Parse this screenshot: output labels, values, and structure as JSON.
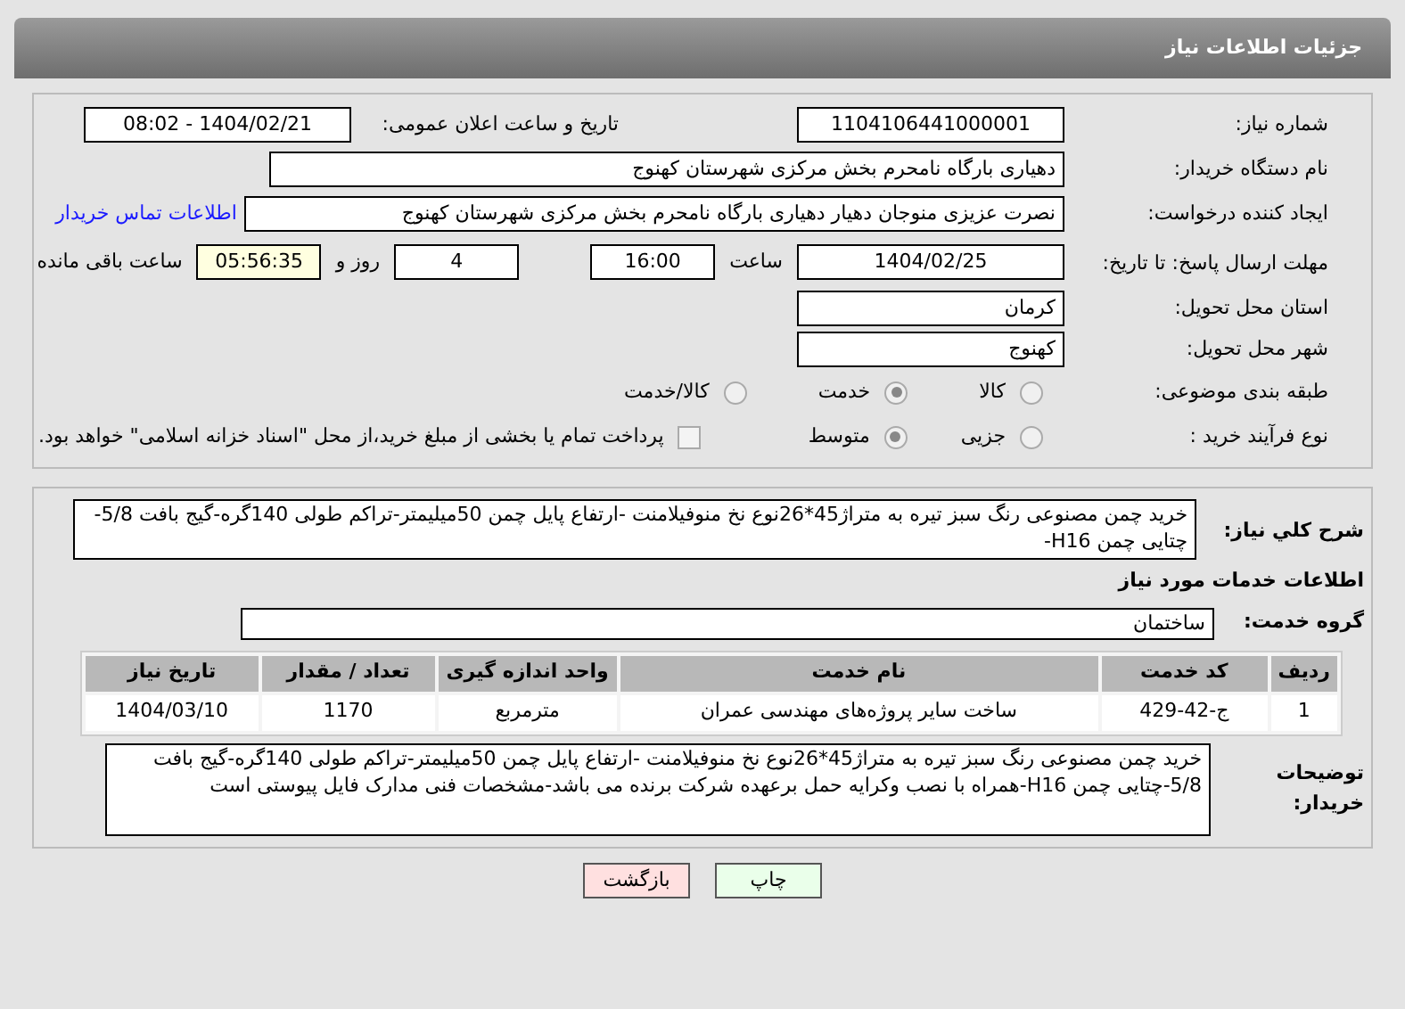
{
  "header": {
    "title": "جزئیات اطلاعات نیاز"
  },
  "need_number": {
    "label": "شماره نیاز:",
    "value": "1104106441000001"
  },
  "announce": {
    "label": "تاریخ و ساعت اعلان عمومی:",
    "value": "1404/02/21 - 08:02"
  },
  "buyer_org": {
    "label": "نام دستگاه خریدار:",
    "value": "دهیاری بارگاه نامحرم بخش مرکزی شهرستان کهنوج"
  },
  "requester": {
    "label": "ایجاد کننده درخواست:",
    "value": "نصرت عزیزی منوجان دهیار دهیاری بارگاه نامحرم بخش مرکزی شهرستان کهنوج",
    "link": "اطلاعات تماس خریدار"
  },
  "deadline": {
    "label": "مهلت ارسال پاسخ: تا تاریخ:",
    "date": "1404/02/25",
    "time_label": "ساعت",
    "time": "16:00",
    "days": "4",
    "days_label": "روز و",
    "remaining": "05:56:35",
    "remaining_label": "ساعت باقی مانده"
  },
  "province": {
    "label": "استان محل تحویل:",
    "value": "کرمان"
  },
  "city": {
    "label": "شهر محل تحویل:",
    "value": "کهنوج"
  },
  "category": {
    "label": "طبقه بندی موضوعی:",
    "options": [
      {
        "label": "کالا",
        "selected": false
      },
      {
        "label": "خدمت",
        "selected": true
      },
      {
        "label": "کالا/خدمت",
        "selected": false
      }
    ]
  },
  "purchase_type": {
    "label": "نوع فرآیند خرید :",
    "options": [
      {
        "label": "جزیی",
        "selected": false
      },
      {
        "label": "متوسط",
        "selected": true
      }
    ],
    "payment": {
      "checked": false,
      "label": "پرداخت تمام یا بخشی از مبلغ خرید،از محل \"اسناد خزانه اسلامی\" خواهد بود."
    }
  },
  "summary": {
    "label": "شرح کلي نياز:",
    "value": "خرید چمن مصنوعی رنگ سبز تیره به متراژ45*26نوع نخ منوفیلامنت -ارتفاع پایل چمن 50میلیمتر-تراکم طولی 140گره-گیج بافت 5/8-چتایی چمن H16-"
  },
  "services_title": "اطلاعات خدمات مورد نياز",
  "service_group": {
    "label": "گروه خدمت:",
    "value": "ساختمان"
  },
  "table": {
    "columns": [
      "ردیف",
      "کد خدمت",
      "نام خدمت",
      "واحد اندازه گیری",
      "تعداد / مقدار",
      "تاریخ نیاز"
    ],
    "rows": [
      [
        "1",
        "ج-42-429",
        "ساخت سایر پروژه‌های مهندسی عمران",
        "مترمربع",
        "1170",
        "1404/03/10"
      ]
    ]
  },
  "buyer_notes": {
    "label": "توضیحات خریدار:",
    "value": "خرید چمن مصنوعی رنگ سبز تیره به متراژ45*26نوع نخ منوفیلامنت -ارتفاع پایل چمن 50میلیمتر-تراکم طولی 140گره-گیج بافت 5/8-چتایی چمن H16-همراه با نصب وکرایه حمل برعهده شرکت برنده می باشد-مشخصات فنی مدارک فایل پیوستی است"
  },
  "buttons": [
    {
      "kind": "print",
      "label": "چاپ"
    },
    {
      "kind": "back",
      "label": "بازگشت"
    }
  ]
}
